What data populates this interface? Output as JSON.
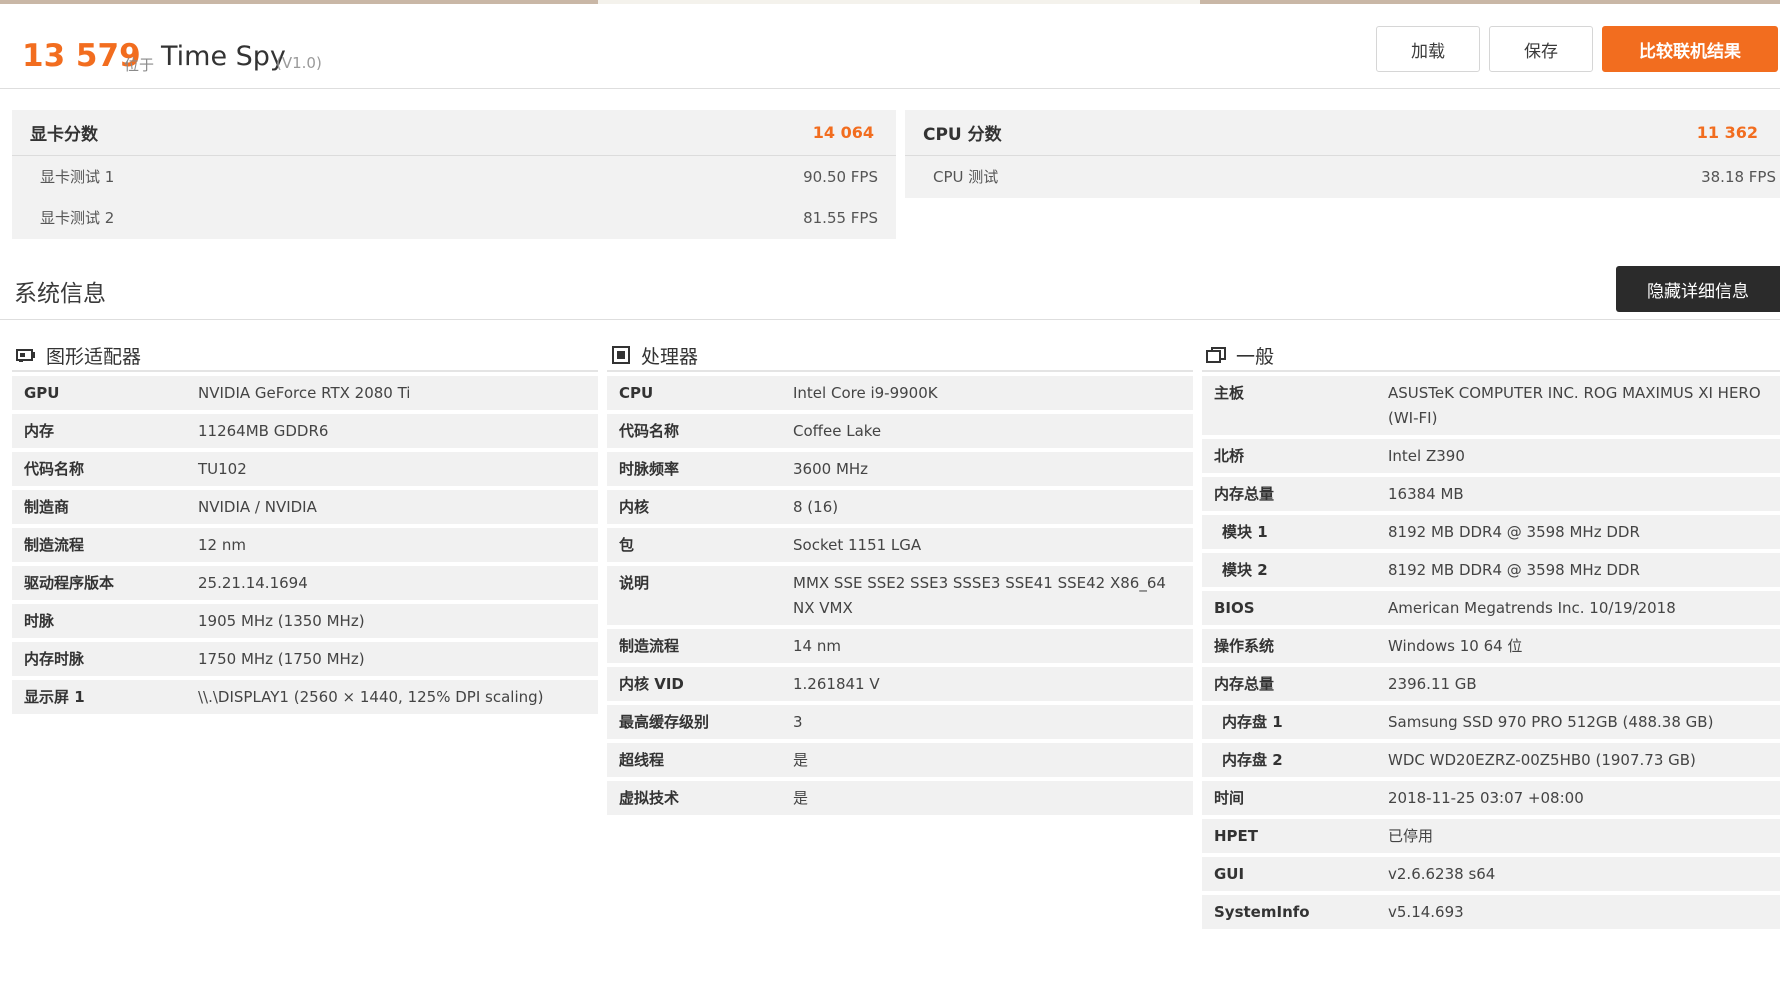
{
  "header": {
    "score": "13 579",
    "at_label": "位于",
    "test_name": "Time Spy",
    "version": "(V1.0)",
    "buttons": {
      "load": "加载",
      "save": "保存",
      "compare": "比较联机结果"
    }
  },
  "scores": {
    "gpu": {
      "title": "显卡分数",
      "value": "14 064",
      "tests": [
        {
          "label": "显卡测试 1",
          "value": "90.50 FPS"
        },
        {
          "label": "显卡测试 2",
          "value": "81.55 FPS"
        }
      ]
    },
    "cpu": {
      "title": "CPU 分数",
      "value": "11 362",
      "tests": [
        {
          "label": "CPU 测试",
          "value": "38.18 FPS"
        }
      ]
    }
  },
  "system": {
    "title": "系统信息",
    "hide_button": "隐藏详细信息",
    "gpu_col": {
      "title": "图形适配器",
      "icon": "gpu-card-icon",
      "rows": [
        {
          "k": "GPU",
          "v": "NVIDIA GeForce RTX 2080 Ti"
        },
        {
          "k": "内存",
          "v": "11264MB GDDR6"
        },
        {
          "k": "代码名称",
          "v": "TU102"
        },
        {
          "k": "制造商",
          "v": "NVIDIA / NVIDIA"
        },
        {
          "k": "制造流程",
          "v": "12 nm"
        },
        {
          "k": "驱动程序版本",
          "v": "25.21.14.1694"
        },
        {
          "k": "时脉",
          "v": "1905 MHz (1350 MHz)"
        },
        {
          "k": "内存时脉",
          "v": "1750 MHz (1750 MHz)"
        },
        {
          "k": "显示屏 1",
          "v": "\\\\.\\DISPLAY1 (2560 × 1440, 125% DPI scaling)"
        }
      ]
    },
    "cpu_col": {
      "title": "处理器",
      "icon": "cpu-chip-icon",
      "rows": [
        {
          "k": "CPU",
          "v": "Intel Core i9-9900K"
        },
        {
          "k": "代码名称",
          "v": "Coffee Lake"
        },
        {
          "k": "时脉频率",
          "v": "3600 MHz"
        },
        {
          "k": "内核",
          "v": "8 (16)"
        },
        {
          "k": "包",
          "v": "Socket 1151 LGA"
        },
        {
          "k": "说明",
          "v": "MMX SSE SSE2 SSE3 SSSE3 SSE41 SSE42 X86_64 NX VMX"
        },
        {
          "k": "制造流程",
          "v": "14 nm"
        },
        {
          "k": "内核 VID",
          "v": "1.261841 V"
        },
        {
          "k": "最高缓存级别",
          "v": "3"
        },
        {
          "k": "超线程",
          "v": "是"
        },
        {
          "k": "虚拟技术",
          "v": "是"
        }
      ]
    },
    "general_col": {
      "title": "一般",
      "icon": "windows-icon",
      "rows": [
        {
          "k": "主板",
          "v": "ASUSTeK COMPUTER INC. ROG MAXIMUS XI HERO (WI-FI)"
        },
        {
          "k": "北桥",
          "v": "Intel Z390"
        },
        {
          "k": "内存总量",
          "v": "16384 MB"
        },
        {
          "k": "模块 1",
          "v": "8192 MB DDR4 @ 3598 MHz DDR",
          "sub": true
        },
        {
          "k": "模块 2",
          "v": "8192 MB DDR4 @ 3598 MHz DDR",
          "sub": true
        },
        {
          "k": "BIOS",
          "v": "American Megatrends Inc. 10/19/2018"
        },
        {
          "k": "操作系统",
          "v": "Windows 10 64 位"
        },
        {
          "k": "内存总量",
          "v": "2396.11 GB"
        },
        {
          "k": "内存盘 1",
          "v": "Samsung SSD 970 PRO 512GB (488.38 GB)",
          "sub": true
        },
        {
          "k": "内存盘 2",
          "v": "WDC WD20EZRZ-00Z5HB0 (1907.73 GB)",
          "sub": true
        },
        {
          "k": "时间",
          "v": "2018-11-25 03:07 +08:00"
        },
        {
          "k": "HPET",
          "v": "已停用"
        },
        {
          "k": "GUI",
          "v": "v2.6.6238 s64"
        },
        {
          "k": "SystemInfo",
          "v": "v5.14.693"
        }
      ]
    }
  },
  "colors": {
    "accent": "#f26d1f",
    "dark_button": "#2b2b2b",
    "panel_bg": "#f2f2f2"
  }
}
